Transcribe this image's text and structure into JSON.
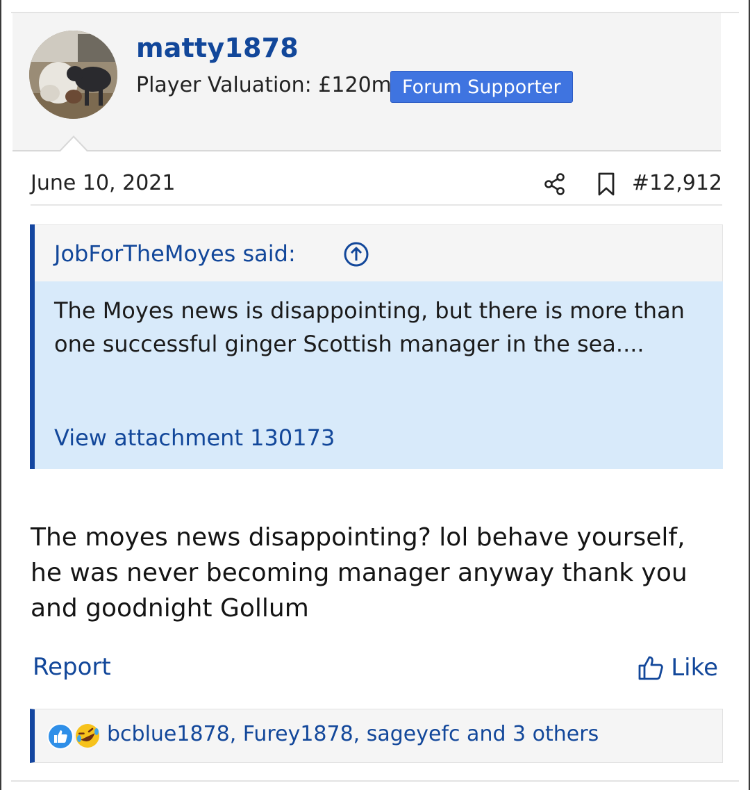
{
  "user": {
    "name": "matty1878",
    "valuation": "Player Valuation: £120m",
    "badge": "Forum Supporter"
  },
  "post": {
    "date": "June 10, 2021",
    "number": "#12,912",
    "body": "The moyes news disappointing? lol behave yourself, he was never becoming manager anyway thank you and goodnight Gollum"
  },
  "quote": {
    "author": "JobForTheMoyes said:",
    "text": "The Moyes news is disappointing, but there is more than one successful ginger Scottish manager in the sea....",
    "attachment": "View attachment 130173"
  },
  "actions": {
    "report": "Report",
    "like": "Like"
  },
  "reactions": {
    "users": "bcblue1878, Furey1878, sageyefc and 3 others",
    "icons": [
      "like-icon",
      "laugh-icon"
    ]
  },
  "colors": {
    "link": "#12479a",
    "badge": "#3f74e0",
    "quote_bg": "#d8eafa",
    "accent_bar": "#1446a0"
  },
  "icons": {
    "share": "share-icon",
    "bookmark": "bookmark-icon",
    "quote_jump": "arrow-up-circle-icon",
    "like": "thumbs-up-icon"
  }
}
